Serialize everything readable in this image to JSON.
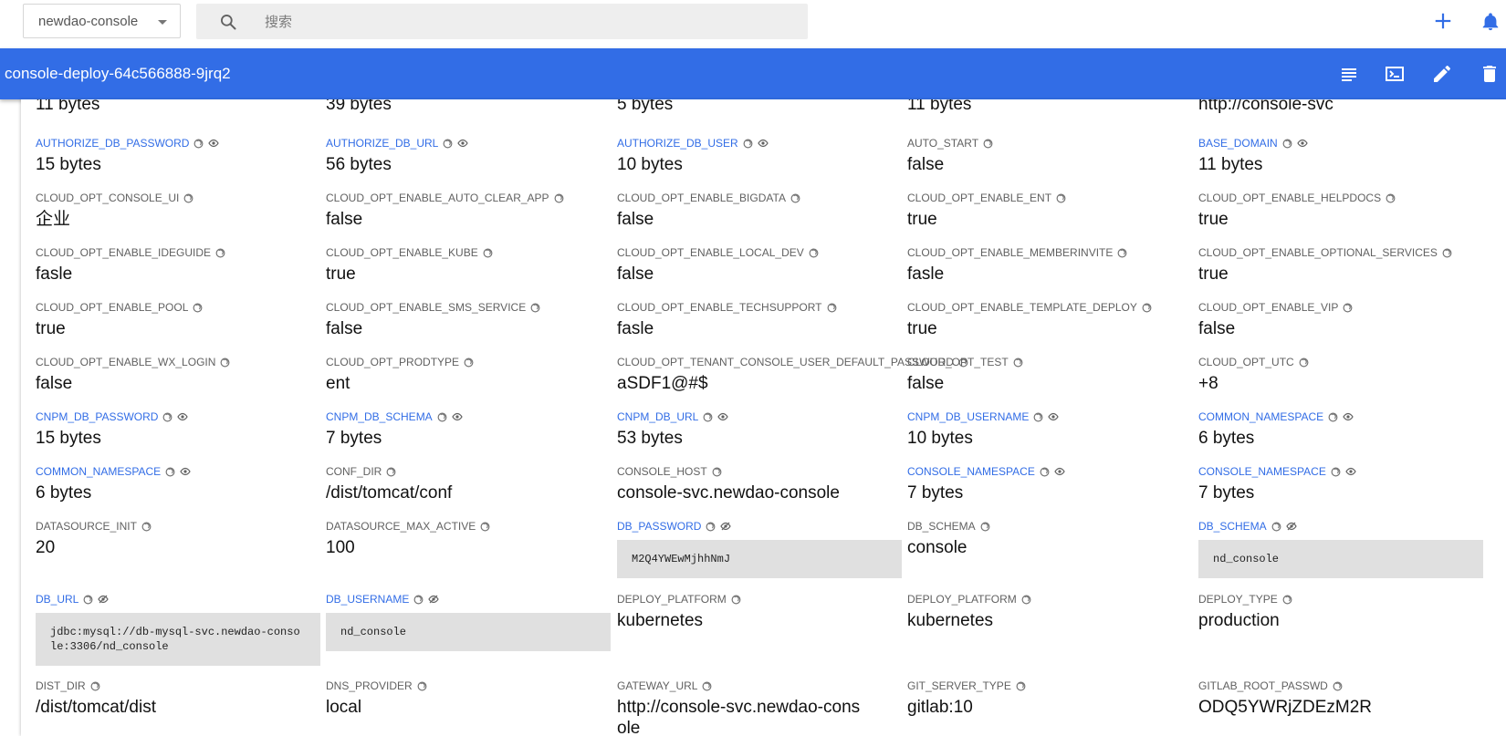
{
  "topbar": {
    "namespace": "newdao-console",
    "search_placeholder": "搜索"
  },
  "titlebar": {
    "title": "console-deploy-64c566888-9jrq2"
  },
  "icons": {
    "search": "search-icon",
    "add": "plus-icon",
    "notifications": "bell-icon",
    "logs": "logs-icon",
    "exec": "exec-icon",
    "edit": "edit-icon",
    "delete": "delete-icon",
    "visibility": "eye-icon",
    "hidden": "eye-off-icon",
    "info": "info-icon"
  },
  "colors": {
    "accent": "#326de6",
    "secret_bg": "#e0e0e0"
  },
  "row0_values": [
    "11 bytes",
    "39 bytes",
    "5 bytes",
    "11 bytes",
    "http://console-svc"
  ],
  "env": [
    [
      {
        "name": "AUTHORIZE_DB_PASSWORD",
        "value": "15 bytes",
        "link": true,
        "eye": true
      },
      {
        "name": "AUTHORIZE_DB_URL",
        "value": "56 bytes",
        "link": true,
        "eye": true
      },
      {
        "name": "AUTHORIZE_DB_USER",
        "value": "10 bytes",
        "link": true,
        "eye": true
      },
      {
        "name": "AUTO_START",
        "value": "false"
      },
      {
        "name": "BASE_DOMAIN",
        "value": "11 bytes",
        "link": true,
        "eye": true
      }
    ],
    [
      {
        "name": "CLOUD_OPT_CONSOLE_UI",
        "value": "企业"
      },
      {
        "name": "CLOUD_OPT_ENABLE_AUTO_CLEAR_APP",
        "value": "false"
      },
      {
        "name": "CLOUD_OPT_ENABLE_BIGDATA",
        "value": "false"
      },
      {
        "name": "CLOUD_OPT_ENABLE_ENT",
        "value": "true"
      },
      {
        "name": "CLOUD_OPT_ENABLE_HELPDOCS",
        "value": "true"
      }
    ],
    [
      {
        "name": "CLOUD_OPT_ENABLE_IDEGUIDE",
        "value": "fasle"
      },
      {
        "name": "CLOUD_OPT_ENABLE_KUBE",
        "value": "true"
      },
      {
        "name": "CLOUD_OPT_ENABLE_LOCAL_DEV",
        "value": "false"
      },
      {
        "name": "CLOUD_OPT_ENABLE_MEMBERINVITE",
        "value": "fasle"
      },
      {
        "name": "CLOUD_OPT_ENABLE_OPTIONAL_SERVICES",
        "value": "true"
      }
    ],
    [
      {
        "name": "CLOUD_OPT_ENABLE_POOL",
        "value": "true"
      },
      {
        "name": "CLOUD_OPT_ENABLE_SMS_SERVICE",
        "value": "false"
      },
      {
        "name": "CLOUD_OPT_ENABLE_TECHSUPPORT",
        "value": "fasle"
      },
      {
        "name": "CLOUD_OPT_ENABLE_TEMPLATE_DEPLOY",
        "value": "true"
      },
      {
        "name": "CLOUD_OPT_ENABLE_VIP",
        "value": "false"
      }
    ],
    [
      {
        "name": "CLOUD_OPT_ENABLE_WX_LOGIN",
        "value": "false"
      },
      {
        "name": "CLOUD_OPT_PRODTYPE",
        "value": "ent"
      },
      {
        "name": "CLOUD_OPT_TENANT_CONSOLE_USER_DEFAULT_PASSWORD",
        "value": "aSDF1@#$"
      },
      {
        "name": "CLOUD_OPT_TEST",
        "value": "false"
      },
      {
        "name": "CLOUD_OPT_UTC",
        "value": "+8"
      }
    ],
    [
      {
        "name": "CNPM_DB_PASSWORD",
        "value": "15 bytes",
        "link": true,
        "eye": true
      },
      {
        "name": "CNPM_DB_SCHEMA",
        "value": "7 bytes",
        "link": true,
        "eye": true
      },
      {
        "name": "CNPM_DB_URL",
        "value": "53 bytes",
        "link": true,
        "eye": true
      },
      {
        "name": "CNPM_DB_USERNAME",
        "value": "10 bytes",
        "link": true,
        "eye": true
      },
      {
        "name": "COMMON_NAMESPACE",
        "value": "6 bytes",
        "link": true,
        "eye": true
      }
    ],
    [
      {
        "name": "COMMON_NAMESPACE",
        "value": "6 bytes",
        "link": true,
        "eye": true
      },
      {
        "name": "CONF_DIR",
        "value": "/dist/tomcat/conf"
      },
      {
        "name": "CONSOLE_HOST",
        "value": "console-svc.newdao-console"
      },
      {
        "name": "CONSOLE_NAMESPACE",
        "value": "7 bytes",
        "link": true,
        "eye": true
      },
      {
        "name": "CONSOLE_NAMESPACE",
        "value": "7 bytes",
        "link": true,
        "eye": true
      }
    ],
    [
      {
        "name": "DATASOURCE_INIT",
        "value": "20"
      },
      {
        "name": "DATASOURCE_MAX_ACTIVE",
        "value": "100"
      },
      {
        "name": "DB_PASSWORD",
        "value": "M2Q4YWEwMjhhNmJ",
        "link": true,
        "eyeoff": true,
        "secret": true
      },
      {
        "name": "DB_SCHEMA",
        "value": "console"
      },
      {
        "name": "DB_SCHEMA",
        "value": "nd_console",
        "link": true,
        "eyeoff": true,
        "secret": true
      }
    ],
    [
      {
        "name": "DB_URL",
        "value": "jdbc:mysql://db-mysql-svc.newdao-console:3306/nd_console",
        "link": true,
        "eyeoff": true,
        "secret": true
      },
      {
        "name": "DB_USERNAME",
        "value": "nd_console",
        "link": true,
        "eyeoff": true,
        "secret": true
      },
      {
        "name": "DEPLOY_PLATFORM",
        "value": "kubernetes"
      },
      {
        "name": "DEPLOY_PLATFORM",
        "value": "kubernetes"
      },
      {
        "name": "DEPLOY_TYPE",
        "value": "production"
      }
    ],
    [
      {
        "name": "DIST_DIR",
        "value": "/dist/tomcat/dist"
      },
      {
        "name": "DNS_PROVIDER",
        "value": "local"
      },
      {
        "name": "GATEWAY_URL",
        "value": "http://console-svc.newdao-console",
        "wrap": true
      },
      {
        "name": "GIT_SERVER_TYPE",
        "value": "gitlab:10"
      },
      {
        "name": "GITLAB_ROOT_PASSWD",
        "value": "ODQ5YWRjZDEzM2R"
      }
    ]
  ]
}
